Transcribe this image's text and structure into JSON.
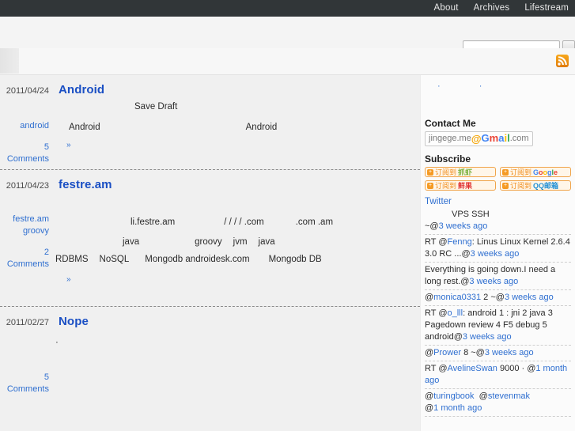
{
  "topnav": {
    "items": [
      {
        "label": "About"
      },
      {
        "label": "Archives"
      },
      {
        "label": "Lifestream"
      }
    ]
  },
  "search": {
    "value": "",
    "placeholder": "",
    "button_label": ""
  },
  "header": {
    "rss_icon": "rss-icon",
    "logo_alt": ""
  },
  "posts": [
    {
      "date": "2011/04/24",
      "title": "Android",
      "tags": [
        "android"
      ],
      "comments": "5 Comments",
      "lines": [
        [
          {
            "t": "",
            "indent": 40
          },
          {
            "t": "Save Draft"
          }
        ],
        [
          {
            "t": "Android",
            "indent": 20
          },
          {
            "t": "Android",
            "indent": 220
          }
        ]
      ],
      "more": "»"
    },
    {
      "date": "2011/04/23",
      "title": "festre.am",
      "tags": [
        "festre.am",
        "groovy"
      ],
      "comments": "2 Comments",
      "lines": [
        [
          {
            "t": ""
          }
        ],
        [
          {
            "t": "li.festre.am",
            "indent": 140
          },
          {
            "t": "/  /   /  /   .com",
            "indent": 62
          },
          {
            "t": ".com .am",
            "indent": 40
          }
        ],
        [
          {
            "t": "java",
            "indent": 120
          },
          {
            "t": "groovy",
            "indent": 100
          },
          {
            "t": "jvm",
            "indent": 18
          },
          {
            "t": "java",
            "indent": 16
          }
        ],
        [
          {
            "t": "RDBMS",
            "indent": 0
          },
          {
            "t": "NoSQL",
            "indent": 16
          },
          {
            "t": "Mongodb androidesk.com",
            "indent": 22
          },
          {
            "t": "Mongodb  DB",
            "indent": 34
          }
        ]
      ],
      "more": "»"
    },
    {
      "date": "2011/02/27",
      "title": "Nope",
      "tags": [],
      "comments": "5 Comments",
      "lines": [
        [
          {
            "t": "·",
            "indent": 30
          }
        ]
      ],
      "more": ""
    }
  ],
  "sidebar": {
    "toplinks": [
      {
        "label": "·"
      },
      {
        "label": "·"
      }
    ],
    "contact": {
      "title": "Contact Me",
      "email_user": "jingege.me",
      "email_at": "@",
      "email_brand": "Gmail",
      "email_tld": ".com"
    },
    "subscribe": {
      "title": "Subscribe",
      "buttons": [
        {
          "plus": "+",
          "text": "订阅到",
          "brand": "抓虾",
          "brand_class": "brand-zhuaxia"
        },
        {
          "plus": "+",
          "text": "订阅到",
          "brand": "Google",
          "brand_class": "brand-google"
        },
        {
          "plus": "+",
          "text": "订阅到",
          "brand": "鲜果",
          "brand_class": "brand-xianguo"
        },
        {
          "plus": "+",
          "text": "订阅到",
          "brand": "QQ邮箱",
          "brand_class": "brand-qq"
        }
      ]
    },
    "twitter": {
      "title": "Twitter",
      "items": [
        {
          "text": "VPS  SSH",
          "prefix": "",
          "handle": "",
          "suffix": "~@",
          "time": "3 weeks ago"
        },
        {
          "text": "RT @Fenng: Linus       Linux Kernel 2.6.4       3.0 RC ...@",
          "prefix": "RT @",
          "handle": "Fenng",
          "body": ": Linus       Linux Kernel 2.6.4       3.0 RC ...@",
          "time": "3 weeks ago"
        },
        {
          "prefix": "",
          "handle": "",
          "body": "Everything is going down.I need a long rest.@",
          "time": "3 weeks ago"
        },
        {
          "prefix": "@",
          "handle": "monica0331",
          "body": "   2      ~@",
          "time": "3 weeks ago"
        },
        {
          "prefix": "RT @",
          "handle": "o_lll",
          "body": ": android      1          :  jni  2        java  3       Pagedown   review  4      F5  debug  5     android@",
          "time": "3 weeks ago"
        },
        {
          "prefix": "@",
          "handle": "Prower",
          "body": "        8            ~@",
          "time": "3 weeks ago"
        },
        {
          "prefix": "RT @",
          "handle": "AvelineSwan",
          "body": "            9000            ·                    @",
          "time": "1 month ago"
        },
        {
          "prefix": "@",
          "handle": "turingbook",
          "handle2": "stevenmak",
          "body": "@",
          "time": "1 month ago"
        }
      ]
    }
  },
  "colors": {
    "topbar": "#313638",
    "link": "#2f6fd0",
    "title": "#1a4fc4",
    "accent_orange": "#f08c1b",
    "page_bg": "#f0f0f0"
  }
}
